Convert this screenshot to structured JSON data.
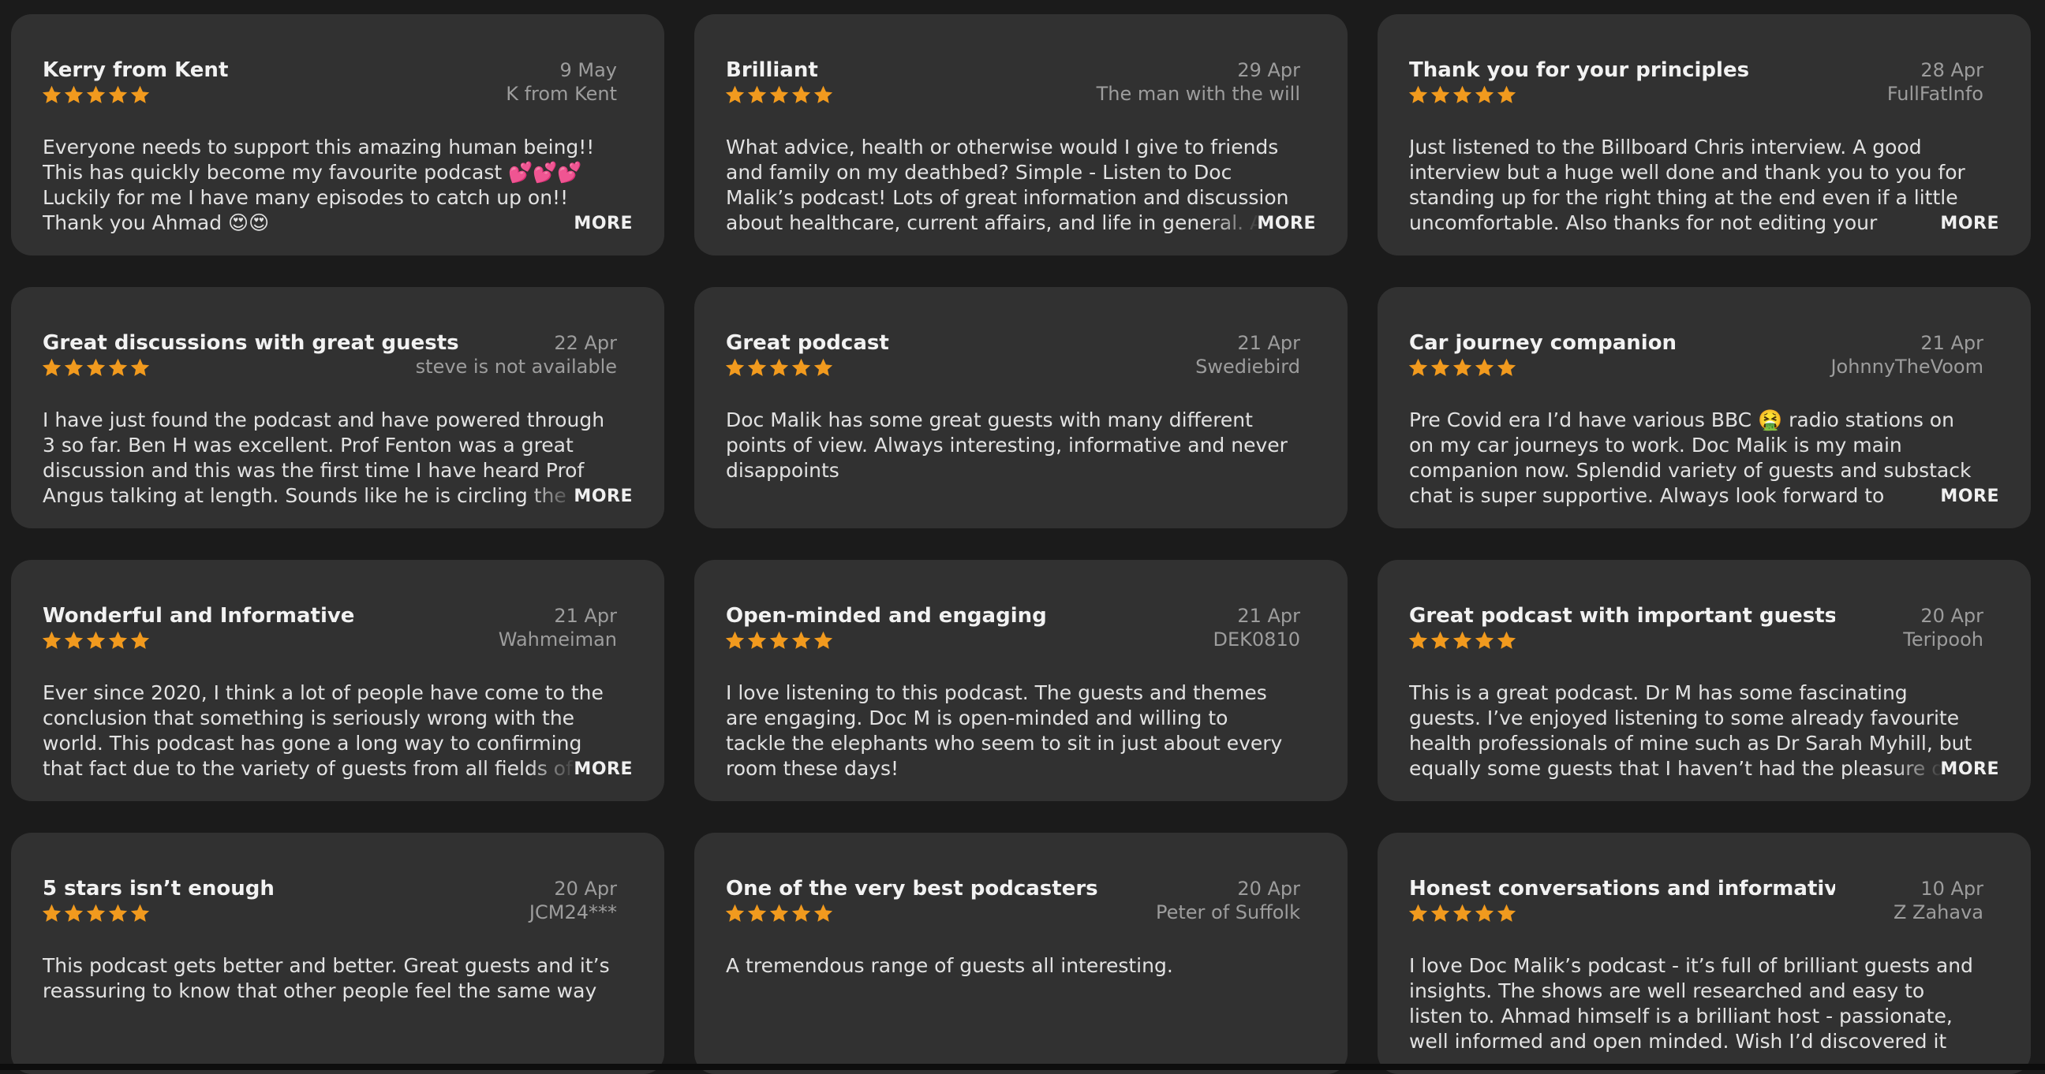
{
  "colors": {
    "background": "#1b1b1b",
    "card": "#313131",
    "star": "#f19a1e",
    "secondary_text": "#9d9d9d"
  },
  "more_label": "MORE",
  "reviews": [
    {
      "title": "Kerry from Kent",
      "date": "9 May",
      "author": "K from Kent",
      "rating": 5,
      "has_more": true,
      "body": "Everyone needs to support this amazing human being!! This has quickly become my favourite podcast 💕💕💕Luckily for me I have many episodes to catch up on!! Thank you Ahmad 😍😍"
    },
    {
      "title": "Brilliant",
      "date": "29 Apr",
      "author": "The man with the will",
      "rating": 5,
      "has_more": true,
      "body": "What advice, health or otherwise would I give to friends and family on my deathbed? Simple - Listen to Doc Malik’s podcast! Lots of great information and discussion about healthcare, current affairs, and life in general. All delivered"
    },
    {
      "title": "Thank you for your principles",
      "date": "28 Apr",
      "author": "FullFatInfo",
      "rating": 5,
      "has_more": true,
      "body": "Just listened to the Billboard Chris interview. A good interview but a huge well done and thank you to you for standing up for the right thing  at the end even if a little uncomfortable. Also thanks for not  editing your conversation"
    },
    {
      "title": "Great discussions with great guests",
      "date": "22 Apr",
      "author": "steve is not available",
      "rating": 5,
      "has_more": true,
      "body": "I have just found the podcast and have powered through 3 so far. Ben H was excellent. Prof Fenton was a great discussion and this was the first time I have heard Prof Angus talking at length. Sounds like he is circling the rabbit hole fast. The"
    },
    {
      "title": "Great podcast",
      "date": "21 Apr",
      "author": "Swediebird",
      "rating": 5,
      "has_more": false,
      "body": "Doc Malik has some great guests with many different points of view. Always interesting, informative and never disappoints"
    },
    {
      "title": "Car journey companion",
      "date": "21 Apr",
      "author": "JohnnyTheVoom",
      "rating": 5,
      "has_more": true,
      "body": "Pre Covid era I’d have various BBC 🤮 radio stations on on my car journeys to work. Doc Malik is my main companion now. Splendid variety of guests and substack chat is super supportive. Always look forward to downloading the latest"
    },
    {
      "title": "Wonderful and Informative",
      "date": "21 Apr",
      "author": "Wahmeiman",
      "rating": 5,
      "has_more": true,
      "body": "Ever since 2020, I think a lot of people have come to the conclusion that something is seriously wrong with the world. This podcast has gone a long way to confirming that fact due to the variety of guests from all fields of society, explaining"
    },
    {
      "title": "Open-minded and engaging",
      "date": "21 Apr",
      "author": "DEK0810",
      "rating": 5,
      "has_more": false,
      "body": "I love listening to this podcast. The guests and themes are engaging. Doc M is open-minded and willing to tackle the elephants who seem to sit in just about every room these days!"
    },
    {
      "title": "Great podcast with important guests",
      "date": "20 Apr",
      "author": "Teripooh",
      "rating": 5,
      "has_more": true,
      "body": "This is a great podcast. Dr M has some fascinating guests. I’ve enjoyed listening to some already favourite health professionals of mine such as Dr Sarah Myhill, but equally some guests that I haven’t had the pleasure of hearing of"
    },
    {
      "title": "5 stars isn’t enough",
      "date": "20 Apr",
      "author": "JCM24***",
      "rating": 5,
      "has_more": false,
      "body": "This podcast gets better and better. Great guests and it’s reassuring to know that other people feel the same way"
    },
    {
      "title": "One of the very best podcasters",
      "date": "20 Apr",
      "author": "Peter of Suffolk",
      "rating": 5,
      "has_more": false,
      "body": "A tremendous range of guests all interesting."
    },
    {
      "title": "Honest conversations and informative",
      "date": "10 Apr",
      "author": "Z Zahava",
      "rating": 5,
      "has_more": false,
      "body": "I love Doc Malik’s podcast - it’s full of brilliant guests and insights. The shows are well researched and easy to listen to. Ahmad himself is a brilliant host - passionate, well informed and open minded. Wish I’d discovered it sooner!"
    }
  ]
}
